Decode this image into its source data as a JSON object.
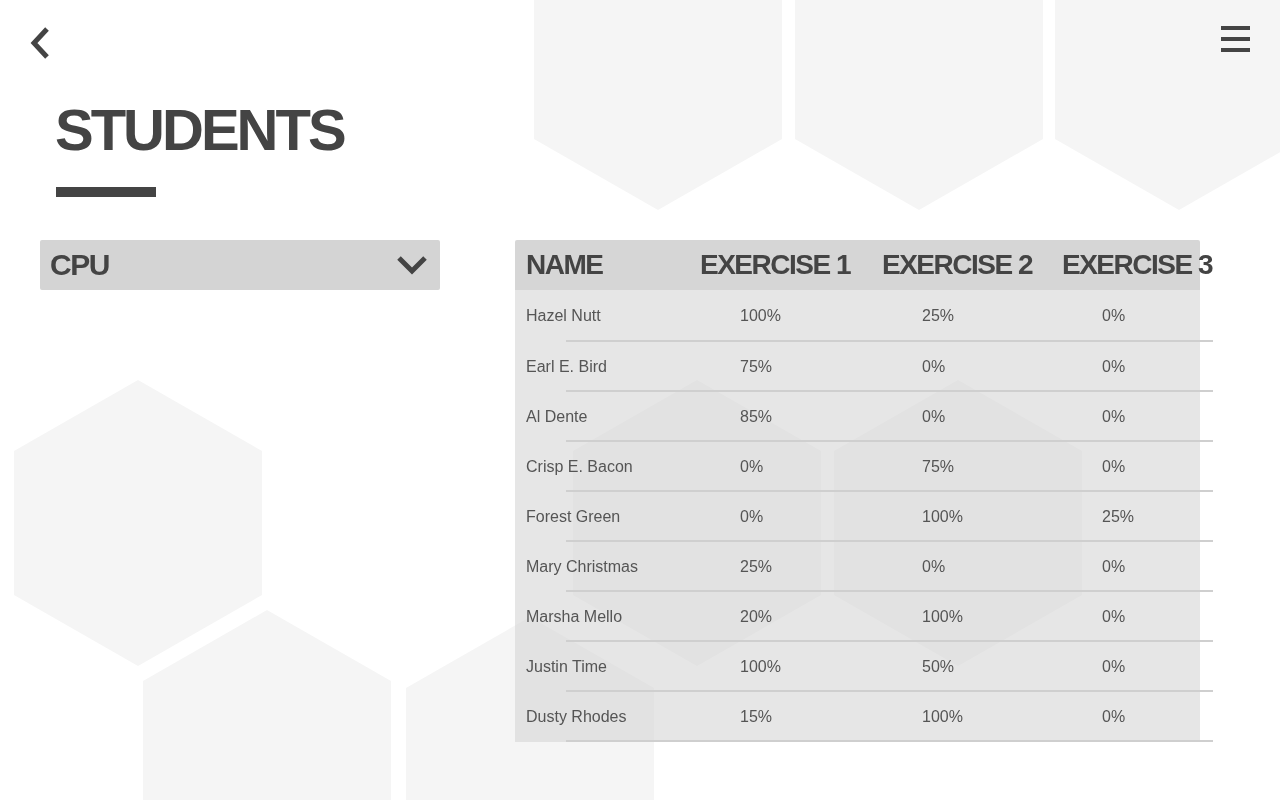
{
  "title": "STUDENTS",
  "filter": {
    "value": "CPU"
  },
  "table": {
    "columns": [
      "NAME",
      "EXERCISE 1",
      "EXERCISE 2",
      "EXERCISE 3"
    ],
    "rows": [
      [
        "Hazel Nutt",
        "100%",
        "25%",
        "0%"
      ],
      [
        "Earl E. Bird",
        "75%",
        "0%",
        "0%"
      ],
      [
        "Al Dente",
        "85%",
        "0%",
        "0%"
      ],
      [
        "Crisp E. Bacon",
        "0%",
        "75%",
        "0%"
      ],
      [
        "Forest Green",
        "0%",
        "100%",
        "25%"
      ],
      [
        "Mary Christmas",
        "25%",
        "0%",
        "0%"
      ],
      [
        "Marsha Mello",
        "20%",
        "100%",
        "0%"
      ],
      [
        "Justin Time",
        "100%",
        "50%",
        "0%"
      ],
      [
        "Dusty Rhodes",
        "15%",
        "100%",
        "0%"
      ]
    ]
  }
}
